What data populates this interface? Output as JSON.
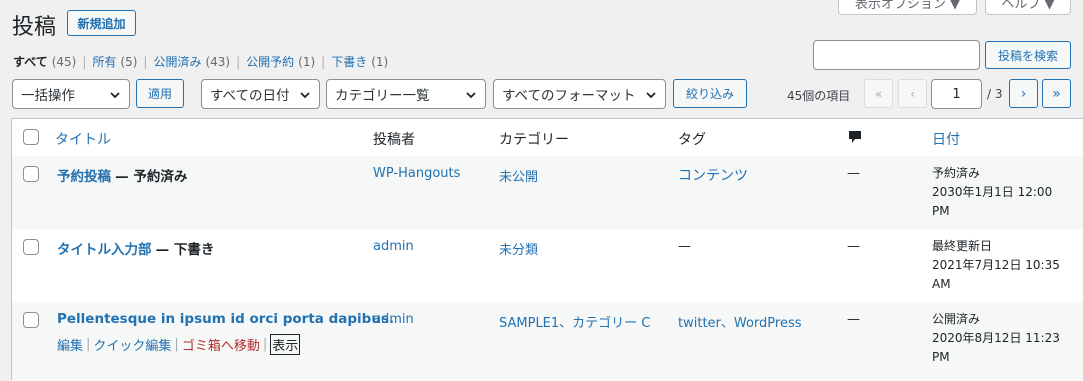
{
  "page_title": "投稿",
  "add_new": "新規追加",
  "top_tabs": {
    "screen_options": "表示オプション ▼",
    "help": "ヘルプ ▼"
  },
  "views": [
    {
      "label": "すべて",
      "count": "(45)",
      "current": true
    },
    {
      "label": "所有",
      "count": "(5)"
    },
    {
      "label": "公開済み",
      "count": "(43)"
    },
    {
      "label": "公開予約",
      "count": "(1)"
    },
    {
      "label": "下書き",
      "count": "(1)"
    }
  ],
  "search": {
    "placeholder": "",
    "button": "投稿を検索"
  },
  "bulk": {
    "select": "一括操作",
    "apply": "適用"
  },
  "filters": {
    "dates": "すべての日付",
    "categories": "カテゴリー一覧",
    "formats": "すべてのフォーマット",
    "filter_btn": "絞り込み"
  },
  "pagination": {
    "items": "45個の項目",
    "first": "«",
    "prev": "‹",
    "current": "1",
    "total": "/ 3",
    "next": "›",
    "last": "»"
  },
  "columns": {
    "title": "タイトル",
    "author": "投稿者",
    "categories": "カテゴリー",
    "tags": "タグ",
    "comments_icon": "comment-bubble-icon",
    "date": "日付"
  },
  "rows": [
    {
      "title": "予約投稿",
      "state": "— 予約済み",
      "author": "WP-Hangouts",
      "categories": "未公開",
      "tags": "コンテンツ",
      "comments": "—",
      "date_status": "予約済み",
      "date_value": "2030年1月1日 12:00 PM"
    },
    {
      "title": "タイトル入力部",
      "state": "— 下書き",
      "author": "admin",
      "categories": "未分類",
      "tags": "—",
      "comments": "—",
      "date_status": "最終更新日",
      "date_value": "2021年7月12日 10:35 AM"
    },
    {
      "title": "Pellentesque in ipsum id orci porta dapibus.",
      "state": "",
      "author": "admin",
      "categories": "SAMPLE1、カテゴリー C",
      "tags": "twitter、WordPress",
      "comments": "—",
      "date_status": "公開済み",
      "date_value": "2020年8月12日 11:23 PM",
      "row_actions": {
        "edit": "編集",
        "quick_edit": "クイック編集",
        "trash": "ゴミ箱へ移動",
        "view": "表示"
      }
    }
  ],
  "colors": {
    "link": "#2271b1",
    "trash": "#b32d2e",
    "border": "#c3c4c7",
    "bg": "#f0f0f1"
  }
}
